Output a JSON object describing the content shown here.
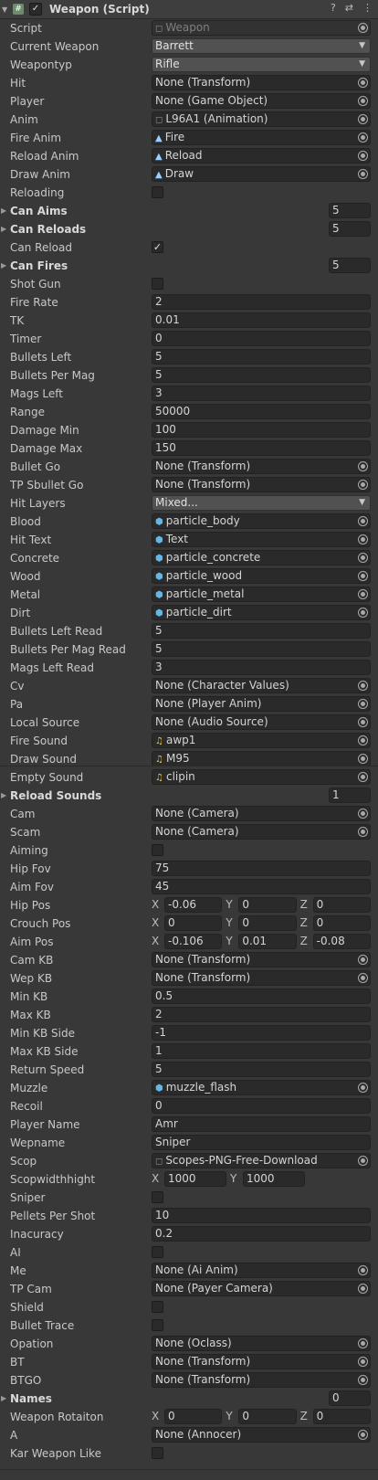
{
  "header": {
    "title": "Weapon (Script)",
    "script_icon_glyph": "#",
    "checkbox_glyph": "✓",
    "fold_glyph": "▼",
    "help_glyph": "?",
    "settings_glyph": "⇄",
    "menu_glyph": "⋮"
  },
  "rows": [
    {
      "label": "Script",
      "type": "object",
      "value": "Weapon",
      "icon": "tex",
      "disabled": true
    },
    {
      "label": "Current Weapon",
      "type": "popup",
      "value": "Barrett"
    },
    {
      "label": "Weapontyp",
      "type": "popup",
      "value": "Rifle"
    },
    {
      "label": "Hit",
      "type": "object",
      "value": "None (Transform)"
    },
    {
      "label": "Player",
      "type": "object",
      "value": "None (Game Object)"
    },
    {
      "label": "Anim",
      "type": "object",
      "value": "L96A1 (Animation)",
      "icon": "tex"
    },
    {
      "label": "Fire Anim",
      "type": "object",
      "value": "Fire",
      "icon": "anim"
    },
    {
      "label": "Reload Anim",
      "type": "object",
      "value": "Reload",
      "icon": "anim"
    },
    {
      "label": "Draw Anim",
      "type": "object",
      "value": "Draw",
      "icon": "anim"
    },
    {
      "label": "Reloading",
      "type": "check",
      "value": false
    },
    {
      "label": "Can Aims",
      "type": "array",
      "value": "5"
    },
    {
      "label": "Can Reloads",
      "type": "array",
      "value": "5"
    },
    {
      "label": "Can Reload",
      "type": "check",
      "value": true
    },
    {
      "label": "Can Fires",
      "type": "array",
      "value": "5"
    },
    {
      "label": "Shot Gun",
      "type": "check",
      "value": false
    },
    {
      "label": "Fire Rate",
      "type": "text",
      "value": "2"
    },
    {
      "label": "TK",
      "type": "text",
      "value": "0.01"
    },
    {
      "label": "Timer",
      "type": "text",
      "value": "0"
    },
    {
      "label": "Bullets Left",
      "type": "text",
      "value": "5"
    },
    {
      "label": "Bullets Per Mag",
      "type": "text",
      "value": "5"
    },
    {
      "label": "Mags Left",
      "type": "text",
      "value": "3"
    },
    {
      "label": "Range",
      "type": "text",
      "value": "50000"
    },
    {
      "label": "Damage Min",
      "type": "text",
      "value": "100"
    },
    {
      "label": "Damage Max",
      "type": "text",
      "value": "150"
    },
    {
      "label": "Bullet Go",
      "type": "object",
      "value": "None (Transform)"
    },
    {
      "label": "TP Sbullet Go",
      "type": "object",
      "value": "None (Transform)"
    },
    {
      "label": "Hit Layers",
      "type": "popup",
      "value": "Mixed..."
    },
    {
      "label": "Blood",
      "type": "object",
      "value": "particle_body",
      "icon": "mesh"
    },
    {
      "label": "Hit Text",
      "type": "object",
      "value": "Text",
      "icon": "mesh"
    },
    {
      "label": "Concrete",
      "type": "object",
      "value": "particle_concrete",
      "icon": "mesh"
    },
    {
      "label": "Wood",
      "type": "object",
      "value": "particle_wood",
      "icon": "mesh"
    },
    {
      "label": "Metal",
      "type": "object",
      "value": "particle_metal",
      "icon": "mesh"
    },
    {
      "label": "Dirt",
      "type": "object",
      "value": "particle_dirt",
      "icon": "mesh"
    },
    {
      "label": "Bullets Left Read",
      "type": "text",
      "value": "5"
    },
    {
      "label": "Bullets Per Mag Read",
      "type": "text",
      "value": "5"
    },
    {
      "label": "Mags Left Read",
      "type": "text",
      "value": "3"
    },
    {
      "label": "Cv",
      "type": "object",
      "value": "None (Character Values)"
    },
    {
      "label": "Pa",
      "type": "object",
      "value": "None (Player Anim)"
    },
    {
      "label": "Local Source",
      "type": "object",
      "value": "None (Audio Source)"
    },
    {
      "label": "Fire Sound",
      "type": "object",
      "value": "awp1",
      "icon": "audio"
    },
    {
      "label": "Draw Sound",
      "type": "object",
      "value": "M95",
      "icon": "audio"
    },
    {
      "label": "Empty Sound",
      "type": "object",
      "value": "clipin",
      "icon": "audio"
    },
    {
      "label": "Reload Sounds",
      "type": "array",
      "value": "1"
    },
    {
      "label": "Cam",
      "type": "object",
      "value": "None (Camera)"
    },
    {
      "label": "Scam",
      "type": "object",
      "value": "None (Camera)"
    },
    {
      "label": "Aiming",
      "type": "check",
      "value": false
    },
    {
      "label": "Hip Fov",
      "type": "text",
      "value": "75"
    },
    {
      "label": "Aim Fov",
      "type": "text",
      "value": "45"
    },
    {
      "label": "Hip Pos",
      "type": "vec3",
      "x": "-0.06",
      "y": "0",
      "z": "0"
    },
    {
      "label": "Crouch Pos",
      "type": "vec3",
      "x": "0",
      "y": "0",
      "z": "0"
    },
    {
      "label": "Aim Pos",
      "type": "vec3",
      "x": "-0.106",
      "y": "0.01",
      "z": "-0.08"
    },
    {
      "label": "Cam KB",
      "type": "object",
      "value": "None (Transform)"
    },
    {
      "label": "Wep KB",
      "type": "object",
      "value": "None (Transform)"
    },
    {
      "label": "Min KB",
      "type": "text",
      "value": "0.5"
    },
    {
      "label": "Max KB",
      "type": "text",
      "value": "2"
    },
    {
      "label": "Min KB Side",
      "type": "text",
      "value": "-1"
    },
    {
      "label": "Max KB Side",
      "type": "text",
      "value": "1"
    },
    {
      "label": "Return Speed",
      "type": "text",
      "value": "5"
    },
    {
      "label": "Muzzle",
      "type": "object",
      "value": "muzzle_flash",
      "icon": "mesh"
    },
    {
      "label": "Recoil",
      "type": "text",
      "value": "0"
    },
    {
      "label": "Player Name",
      "type": "text",
      "value": "Amr"
    },
    {
      "label": "Wepname",
      "type": "text",
      "value": "Sniper"
    },
    {
      "label": "Scop",
      "type": "object",
      "value": "Scopes-PNG-Free-Download",
      "icon": "tex"
    },
    {
      "label": "Scopwidthhight",
      "type": "vec2",
      "x": "1000",
      "y": "1000"
    },
    {
      "label": "Sniper",
      "type": "check",
      "value": false
    },
    {
      "label": "Pellets Per Shot",
      "type": "text",
      "value": "10"
    },
    {
      "label": "Inacuracy",
      "type": "text",
      "value": "0.2"
    },
    {
      "label": "AI",
      "type": "check",
      "value": false
    },
    {
      "label": "Me",
      "type": "object",
      "value": "None (Ai Anim)"
    },
    {
      "label": "TP Cam",
      "type": "object",
      "value": "None (Payer Camera)"
    },
    {
      "label": "Shield",
      "type": "check",
      "value": false
    },
    {
      "label": "Bullet Trace",
      "type": "check",
      "value": false
    },
    {
      "label": "Opation",
      "type": "object",
      "value": "None (Oclass)"
    },
    {
      "label": "BT",
      "type": "object",
      "value": "None (Transform)"
    },
    {
      "label": "BTGO",
      "type": "object",
      "value": "None (Transform)"
    },
    {
      "label": "Names",
      "type": "array",
      "value": "0"
    },
    {
      "label": "Weapon Rotaiton",
      "type": "vec3",
      "x": "0",
      "y": "0",
      "z": "0"
    },
    {
      "label": "A",
      "type": "object",
      "value": "None (Annocer)"
    },
    {
      "label": "Kar Weapon Like",
      "type": "check",
      "value": false
    }
  ],
  "vector_labels": {
    "x": "X",
    "y": "Y",
    "z": "Z"
  },
  "glyphs": {
    "caret": "▼",
    "fold": "▶",
    "check": "✓",
    "anim": "▲",
    "mesh": "⬢",
    "audio": "♫",
    "tex": "◻"
  }
}
